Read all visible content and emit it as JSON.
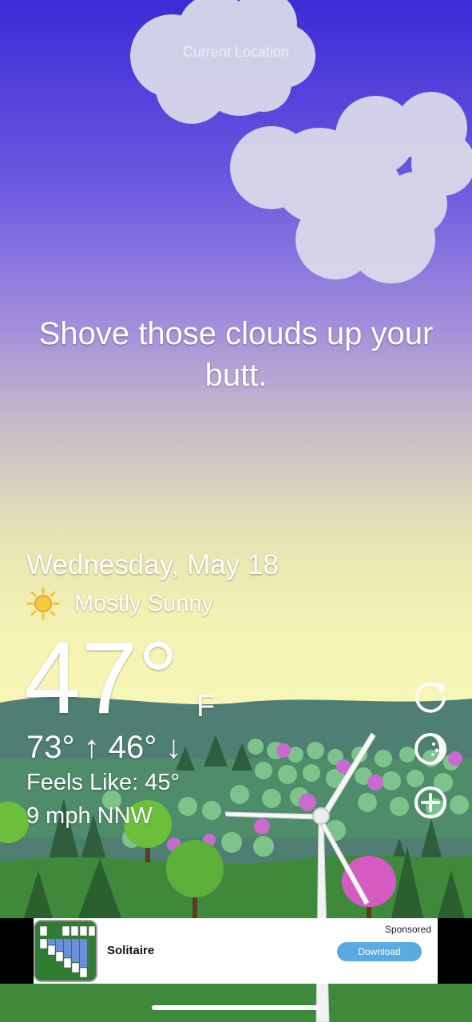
{
  "header": {
    "location_label": "Current Location"
  },
  "quip": "Shove those clouds up your butt.",
  "forecast": {
    "date": "Wednesday, May 18",
    "condition": "Mostly Sunny",
    "condition_icon": "sun-icon",
    "temperature": "47°",
    "unit": "F",
    "high_low": "73° ↑ 46° ↓",
    "feels_like": "Feels Like: 45°",
    "wind": "9 mph NNW"
  },
  "controls": [
    {
      "name": "refresh",
      "icon": "refresh-icon"
    },
    {
      "name": "moon",
      "icon": "moon-icon"
    },
    {
      "name": "add-location",
      "icon": "plus-circle-icon"
    }
  ],
  "ad": {
    "sponsored_label": "Sponsored",
    "app_name": "Solitaire",
    "cta_label": "Download",
    "icon": "solitaire-app-icon"
  },
  "colors": {
    "sky_top": "#3b2bd6",
    "sky_bottom": "#f5f4b2",
    "hill": "#4a7a6e",
    "grass": "#3f8a3a",
    "accent_button": "#5aa9e0"
  }
}
